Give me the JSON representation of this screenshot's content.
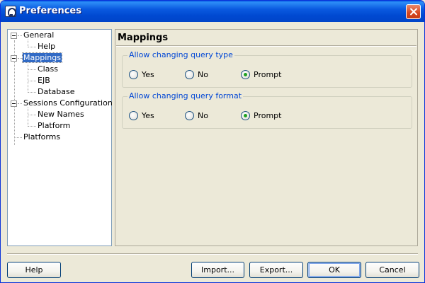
{
  "window": {
    "title": "Preferences"
  },
  "tree": {
    "items": [
      {
        "label": "General",
        "level": 0,
        "expanded": true
      },
      {
        "label": "Help",
        "level": 1
      },
      {
        "label": "Mappings",
        "level": 0,
        "expanded": true,
        "selected": true
      },
      {
        "label": "Class",
        "level": 1
      },
      {
        "label": "EJB",
        "level": 1
      },
      {
        "label": "Database",
        "level": 1
      },
      {
        "label": "Sessions Configuration",
        "level": 0,
        "expanded": true
      },
      {
        "label": "New Names",
        "level": 1
      },
      {
        "label": "Platform",
        "level": 1
      },
      {
        "label": "Platforms",
        "level": 0
      }
    ]
  },
  "panel": {
    "title": "Mappings",
    "groups": [
      {
        "legend": "Allow changing query type",
        "options": [
          "Yes",
          "No",
          "Prompt"
        ],
        "selected": "Prompt"
      },
      {
        "legend": "Allow changing query format",
        "options": [
          "Yes",
          "No",
          "Prompt"
        ],
        "selected": "Prompt"
      }
    ]
  },
  "buttons": {
    "help": "Help",
    "import": "Import...",
    "export": "Export...",
    "ok": "OK",
    "cancel": "Cancel"
  },
  "colors": {
    "titlebar": "#0054e3",
    "selection": "#316ac5",
    "legend_text": "#0046d5",
    "radio_dot": "#21a121"
  }
}
